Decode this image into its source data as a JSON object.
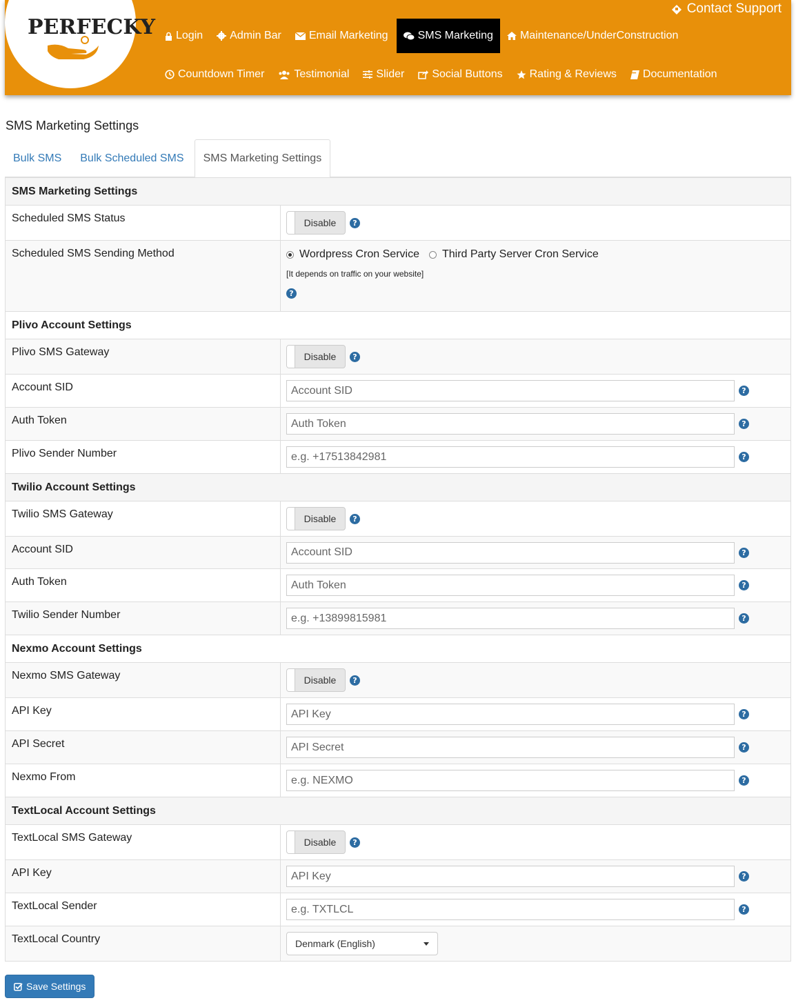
{
  "brand": {
    "logo_text": "PERFECKY"
  },
  "header": {
    "contact_support": "Contact Support",
    "nav_row1": [
      {
        "label": "Login",
        "icon": "lock-icon"
      },
      {
        "label": "Admin Bar",
        "icon": "gear-icon"
      },
      {
        "label": "Email Marketing",
        "icon": "envelope-icon"
      },
      {
        "label": "SMS Marketing",
        "icon": "comments-icon",
        "active": true
      },
      {
        "label": "Maintenance/UnderConstruction",
        "icon": "home-icon"
      }
    ],
    "nav_row2": [
      {
        "label": "Countdown Timer",
        "icon": "clock-icon"
      },
      {
        "label": "Testimonial",
        "icon": "users-icon"
      },
      {
        "label": "Slider",
        "icon": "sliders-icon"
      },
      {
        "label": "Social Buttons",
        "icon": "share-icon"
      },
      {
        "label": "Rating & Reviews",
        "icon": "star-icon"
      },
      {
        "label": "Documentation",
        "icon": "book-icon"
      }
    ]
  },
  "page": {
    "title": "SMS Marketing Settings"
  },
  "tabs": [
    {
      "label": "Bulk SMS",
      "active": false
    },
    {
      "label": "Bulk Scheduled SMS",
      "active": false
    },
    {
      "label": "SMS Marketing Settings",
      "active": true
    }
  ],
  "settings": {
    "general": {
      "heading": "SMS Marketing Settings",
      "scheduled_status_label": "Scheduled SMS Status",
      "scheduled_status_value": "Disable",
      "sending_method_label": "Scheduled SMS Sending Method",
      "method_option1": "Wordpress Cron Service",
      "method_option2": "Third Party Server Cron Service",
      "method_note": "[It depends on traffic on your website]"
    },
    "plivo": {
      "heading": "Plivo Account Settings",
      "gateway_label": "Plivo SMS Gateway",
      "gateway_value": "Disable",
      "sid_label": "Account SID",
      "sid_placeholder": "Account SID",
      "token_label": "Auth Token",
      "token_placeholder": "Auth Token",
      "sender_label": "Plivo Sender Number",
      "sender_placeholder": "e.g. +17513842981"
    },
    "twilio": {
      "heading": "Twilio Account Settings",
      "gateway_label": "Twilio SMS Gateway",
      "gateway_value": "Disable",
      "sid_label": "Account SID",
      "sid_placeholder": "Account SID",
      "token_label": "Auth Token",
      "token_placeholder": "Auth Token",
      "sender_label": "Twilio Sender Number",
      "sender_placeholder": "e.g. +13899815981"
    },
    "nexmo": {
      "heading": "Nexmo Account Settings",
      "gateway_label": "Nexmo SMS Gateway",
      "gateway_value": "Disable",
      "key_label": "API Key",
      "key_placeholder": "API Key",
      "secret_label": "API Secret",
      "secret_placeholder": "API Secret",
      "from_label": "Nexmo From",
      "from_placeholder": "e.g. NEXMO"
    },
    "textlocal": {
      "heading": "TextLocal Account Settings",
      "gateway_label": "TextLocal SMS Gateway",
      "gateway_value": "Disable",
      "key_label": "API Key",
      "key_placeholder": "API Key",
      "sender_label": "TextLocal Sender",
      "sender_placeholder": "e.g. TXTLCL",
      "country_label": "TextLocal Country",
      "country_value": "Denmark (English)"
    }
  },
  "save_button": "Save Settings",
  "colors": {
    "header_bg": "#e8900a",
    "active_nav": "#000000",
    "link": "#337ab7",
    "primary_button": "#337ab7"
  }
}
